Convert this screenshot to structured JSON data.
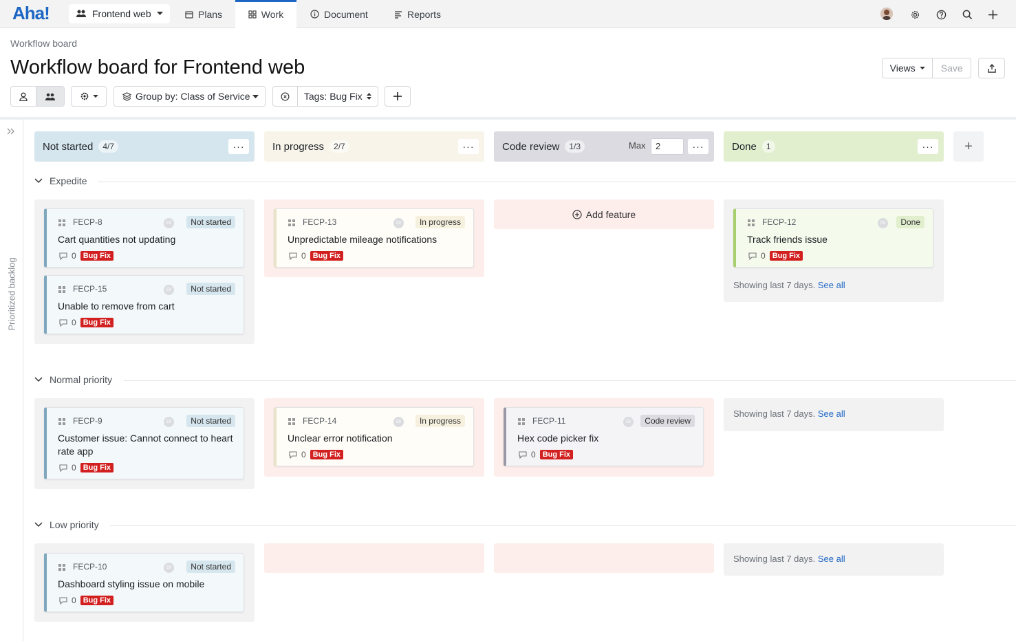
{
  "app": {
    "logo": "Aha!"
  },
  "nav": {
    "workspace": "Frontend web",
    "tabs": [
      {
        "label": "Plans",
        "icon": "calendar-icon"
      },
      {
        "label": "Work",
        "icon": "grid-icon",
        "active": true
      },
      {
        "label": "Document",
        "icon": "info-icon"
      },
      {
        "label": "Reports",
        "icon": "report-icon"
      }
    ]
  },
  "header": {
    "breadcrumb": "Workflow board",
    "title": "Workflow board for Frontend web",
    "views_label": "Views",
    "save_label": "Save"
  },
  "toolbar": {
    "group_by": "Group by: Class of Service",
    "tags_filter": "Tags: Bug Fix"
  },
  "rail": {
    "label": "Prioritized backlog"
  },
  "columns": [
    {
      "title": "Not started",
      "count": "4/7",
      "color": "#d6e6ee"
    },
    {
      "title": "In progress",
      "count": "2/7",
      "color": "#f8f4e9"
    },
    {
      "title": "Code review",
      "count": "1/3",
      "max_label": "Max",
      "max_value": "2",
      "color": "#dcdbe2"
    },
    {
      "title": "Done",
      "count": "1",
      "color": "#e2efcf"
    }
  ],
  "groups": [
    {
      "label": "Expedite"
    },
    {
      "label": "Normal priority"
    },
    {
      "label": "Low priority"
    }
  ],
  "cards": [
    {
      "key": "FECP-8",
      "status": "Not started",
      "title": "Cart quantities not updating",
      "comments": "0",
      "tag": "Bug Fix"
    },
    {
      "key": "FECP-15",
      "status": "Not started",
      "title": "Unable to remove from cart",
      "comments": "0",
      "tag": "Bug Fix"
    },
    {
      "key": "FECP-13",
      "status": "In progress",
      "title": "Unpredictable mileage notifications",
      "comments": "0",
      "tag": "Bug Fix"
    },
    {
      "key": "FECP-12",
      "status": "Done",
      "title": "Track friends issue",
      "comments": "0",
      "tag": "Bug Fix"
    },
    {
      "key": "FECP-9",
      "status": "Not started",
      "title": "Customer issue: Cannot connect to heart rate app",
      "comments": "0",
      "tag": "Bug Fix"
    },
    {
      "key": "FECP-14",
      "status": "In progress",
      "title": "Unclear error notification",
      "comments": "0",
      "tag": "Bug Fix"
    },
    {
      "key": "FECP-11",
      "status": "Code review",
      "title": "Hex code picker fix",
      "comments": "0",
      "tag": "Bug Fix"
    },
    {
      "key": "FECP-10",
      "status": "Not started",
      "title": "Dashboard styling issue on mobile",
      "comments": "0",
      "tag": "Bug Fix"
    }
  ],
  "board": {
    "add_feature": "Add feature",
    "showing_text": "Showing last 7 days.",
    "see_all": "See all",
    "user_initials": "DI"
  },
  "colors": {
    "accent": "#1d66c4",
    "not_started": "#7ea7be",
    "in_progress": "#e9e3c8",
    "code_review": "#9a97a6",
    "done": "#a8cf6e",
    "tag": "#d21f1f"
  }
}
